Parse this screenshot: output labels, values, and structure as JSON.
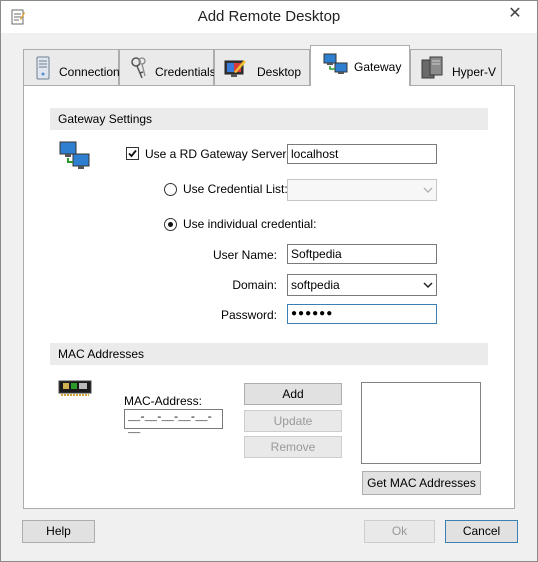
{
  "window": {
    "title": "Add Remote Desktop",
    "close_glyph": "✕"
  },
  "tabs": [
    {
      "label": "Connection",
      "icon": "server-tower-icon"
    },
    {
      "label": "Credentials",
      "icon": "keys-icon"
    },
    {
      "label": "Desktop",
      "icon": "monitor-palette-icon"
    },
    {
      "label": "Gateway",
      "icon": "network-computers-icon"
    },
    {
      "label": "Hyper-V",
      "icon": "server-icon"
    }
  ],
  "active_tab": "Gateway",
  "gateway": {
    "section_title": "Gateway Settings",
    "use_gateway_label": "Use a RD Gateway Server:",
    "use_gateway_checked": true,
    "gateway_server": "localhost",
    "use_credential_list_label": "Use Credential List:",
    "credential_list_value": "",
    "use_individual_label": "Use individual credential:",
    "selected_credential_mode": "individual",
    "username_label": "User Name:",
    "username": "Softpedia",
    "domain_label": "Domain:",
    "domain": "softpedia",
    "password_label": "Password:",
    "password": "●●●●●●"
  },
  "mac": {
    "section_title": "MAC Addresses",
    "address_label": "MAC-Address:",
    "address_mask": "__-__-__-__-__-__",
    "add_label": "Add",
    "update_label": "Update",
    "remove_label": "Remove",
    "get_label": "Get MAC Addresses",
    "addresses": []
  },
  "footer": {
    "help_label": "Help",
    "ok_label": "Ok",
    "cancel_label": "Cancel"
  },
  "colors": {
    "focus_border": "#3c7fb1",
    "disabled_text": "#999999",
    "section_bg": "#ebebeb"
  }
}
